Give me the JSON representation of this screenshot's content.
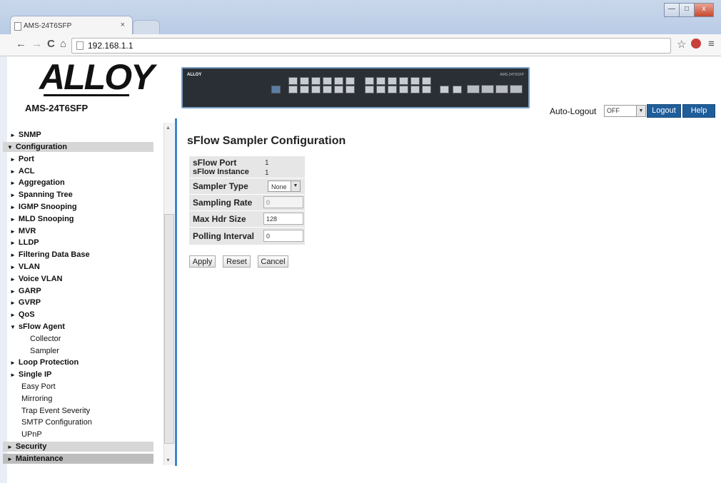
{
  "browser": {
    "tab_title": "AMS-24T6SFP",
    "tab_close": "×",
    "url": "192.168.1.1",
    "back": "←",
    "forward": "→",
    "reload": "C",
    "home": "⌂",
    "star": "☆",
    "menu": "≡",
    "win_minimize": "—",
    "win_maximize": "□",
    "win_close": "x"
  },
  "header": {
    "logo_text": "ALLOY",
    "model": "AMS-24T6SFP",
    "device_brand": "ALLOY",
    "device_model": "AMS-24T6SFP",
    "auto_logout_label": "Auto-Logout",
    "auto_logout_value": "OFF",
    "logout_label": "Logout",
    "help_label": "Help"
  },
  "sidebar": {
    "items": [
      {
        "label": "SNMP",
        "marker": "►"
      },
      {
        "label": "Configuration",
        "marker": "▼"
      },
      {
        "label": "Port",
        "marker": "►"
      },
      {
        "label": "ACL",
        "marker": "►"
      },
      {
        "label": "Aggregation",
        "marker": "►"
      },
      {
        "label": "Spanning Tree",
        "marker": "►"
      },
      {
        "label": "IGMP Snooping",
        "marker": "►"
      },
      {
        "label": "MLD Snooping",
        "marker": "►"
      },
      {
        "label": "MVR",
        "marker": "►"
      },
      {
        "label": "LLDP",
        "marker": "►"
      },
      {
        "label": "Filtering Data Base",
        "marker": "►"
      },
      {
        "label": "VLAN",
        "marker": "►"
      },
      {
        "label": "Voice VLAN",
        "marker": "►"
      },
      {
        "label": "GARP",
        "marker": "►"
      },
      {
        "label": "GVRP",
        "marker": "►"
      },
      {
        "label": "QoS",
        "marker": "►"
      },
      {
        "label": "sFlow Agent",
        "marker": "▼"
      },
      {
        "label": "Collector"
      },
      {
        "label": "Sampler"
      },
      {
        "label": "Loop Protection",
        "marker": "►"
      },
      {
        "label": "Single IP",
        "marker": "►"
      },
      {
        "label": "Easy Port"
      },
      {
        "label": "Mirroring"
      },
      {
        "label": "Trap Event Severity"
      },
      {
        "label": "SMTP Configuration"
      },
      {
        "label": "UPnP"
      },
      {
        "label": "Security",
        "marker": "►"
      },
      {
        "label": "Maintenance",
        "marker": "►"
      }
    ]
  },
  "main": {
    "title": "sFlow Sampler Configuration",
    "fields": {
      "sflow_port_label": "sFlow Port",
      "sflow_port_value": "1",
      "sflow_instance_label": "sFlow Instance",
      "sflow_instance_value": "1",
      "sampler_type_label": "Sampler Type",
      "sampler_type_value": "None",
      "sampling_rate_label": "Sampling Rate",
      "sampling_rate_value": "0",
      "max_hdr_size_label": "Max Hdr Size",
      "max_hdr_size_value": "128",
      "polling_interval_label": "Polling Interval",
      "polling_interval_value": "0"
    },
    "buttons": {
      "apply": "Apply",
      "reset": "Reset",
      "cancel": "Cancel"
    }
  },
  "colors": {
    "accent": "#1f5e9a",
    "sidebar_border": "#3a86c8",
    "section_bg": "#d6d6d6"
  }
}
